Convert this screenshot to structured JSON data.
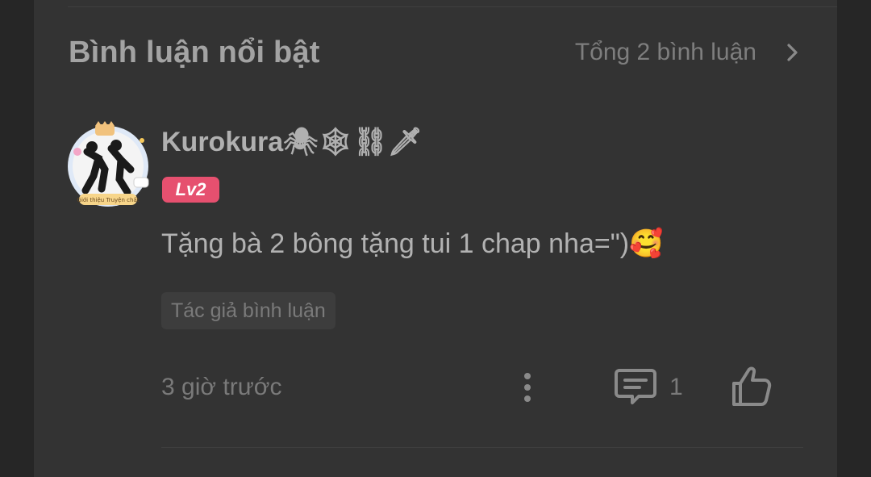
{
  "section": {
    "title": "Bình luận nổi bật",
    "total_label": "Tổng 2 bình luận",
    "chevron_icon": "chevron-right-icon"
  },
  "comment": {
    "avatar_icon": "user-avatar",
    "avatar_frame_text": "Giới thiệu Truyện chất",
    "username": "Kurokura🕷🕸⛓🗡",
    "level": "Lv2",
    "text": "Tặng bà 2 bông tặng tui 1 chap nha=\")🥰",
    "author_tag": "Tác giả bình luận",
    "time": "3 giờ trước",
    "reply_count": "1",
    "more_icon": "more-vertical-icon",
    "reply_icon": "comment-icon",
    "like_icon": "thumbs-up-icon"
  },
  "colors": {
    "background": "#262626",
    "card": "#333333",
    "badge": "#e6506f",
    "title_text": "#a3a3a3",
    "muted_text": "#7a7a7a"
  }
}
